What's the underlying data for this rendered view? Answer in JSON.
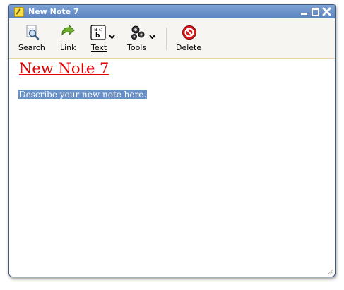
{
  "window": {
    "title": "New Note 7",
    "controls": [
      "minimize",
      "maximize",
      "close"
    ]
  },
  "toolbar": {
    "search_label": "Search",
    "link_label": "Link",
    "text_label": "Text",
    "tools_label": "Tools",
    "delete_label": "Delete",
    "text_icon_glyphs": {
      "a": "a",
      "c": "c",
      "b": "b"
    },
    "icons": [
      "search-icon",
      "link-arrow-icon",
      "text-format-icon",
      "gears-icon",
      "delete-icon"
    ]
  },
  "note": {
    "title": "New Note 7",
    "body_placeholder": "Describe your new note here."
  },
  "colors": {
    "titlebar": "#6b92cb",
    "note_title": "#e00000",
    "selection": "#6a91c5",
    "toolbar_bg": "#f7f5f2",
    "toolbar_border": "#e7cfa6"
  }
}
